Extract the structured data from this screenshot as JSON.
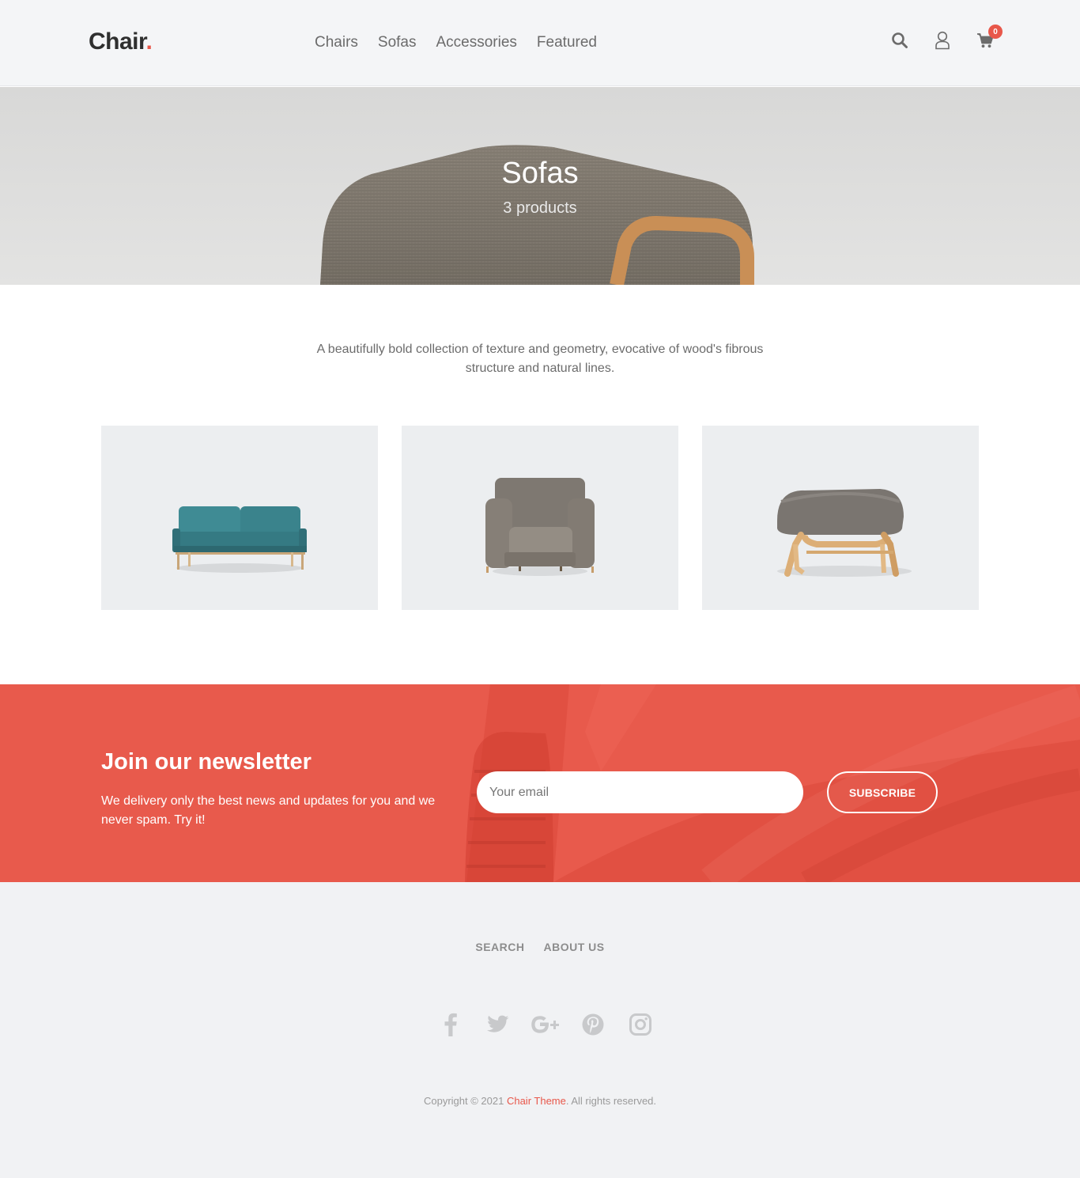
{
  "header": {
    "logo_text": "Chair",
    "logo_dot": ".",
    "nav": [
      "Chairs",
      "Sofas",
      "Accessories",
      "Featured"
    ],
    "icons": [
      "search-icon",
      "user-icon",
      "cart-icon"
    ],
    "cart_count": "0"
  },
  "hero": {
    "title": "Sofas",
    "subtitle": "3 products"
  },
  "collection": {
    "description": "A beautifully bold collection of texture and geometry, evocative of wood's fibrous structure and natural lines."
  },
  "products": [
    {
      "image": "teal-sofa"
    },
    {
      "image": "grey-armchair"
    },
    {
      "image": "grey-ottoman"
    }
  ],
  "newsletter": {
    "title": "Join our newsletter",
    "text": "We delivery only the best news and updates for you and we never spam. Try it!",
    "email_placeholder": "Your email",
    "button_label": "SUBSCRIBE"
  },
  "footer": {
    "links": [
      "SEARCH",
      "ABOUT US"
    ],
    "socials": [
      "facebook-icon",
      "twitter-icon",
      "google-plus-icon",
      "pinterest-icon",
      "instagram-icon"
    ],
    "copyright_prefix": "Copyright © 2021 ",
    "copyright_link": "Chair Theme",
    "copyright_suffix": ". All rights reserved."
  },
  "colors": {
    "accent": "#e8574a",
    "header_bg": "#f4f5f7",
    "footer_bg": "#f1f2f4",
    "newsletter_bg": "#e85a4c",
    "teal_sofa": "#3f8b94"
  }
}
